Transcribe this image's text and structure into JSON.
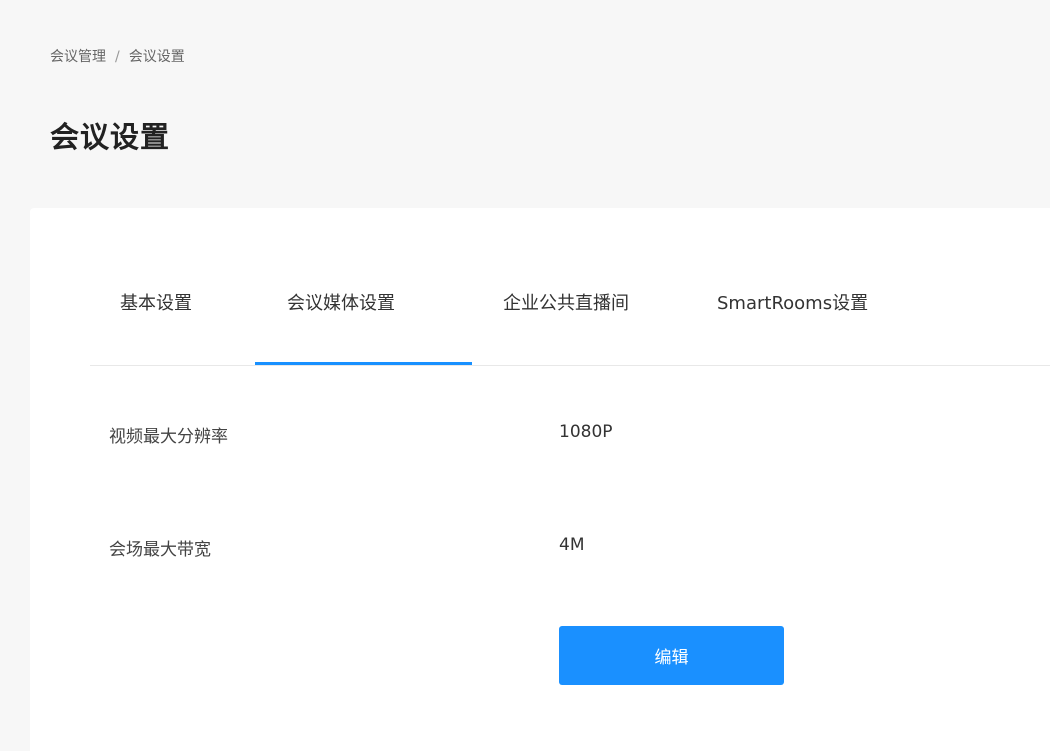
{
  "breadcrumb": {
    "items": [
      "会议管理",
      "会议设置"
    ],
    "separator": "/"
  },
  "page_title": "会议设置",
  "tabs": {
    "items": [
      {
        "label": "基本设置",
        "active": false
      },
      {
        "label": "会议媒体设置",
        "active": true
      },
      {
        "label": "企业公共直播间",
        "active": false
      },
      {
        "label": "SmartRooms设置",
        "active": false
      }
    ],
    "active_color": "#1890ff"
  },
  "settings": {
    "rows": [
      {
        "label": "视频最大分辨率",
        "value": "1080P"
      },
      {
        "label": "会场最大带宽",
        "value": "4M"
      }
    ]
  },
  "actions": {
    "edit_label": "编辑",
    "edit_color": "#1a90ff"
  }
}
